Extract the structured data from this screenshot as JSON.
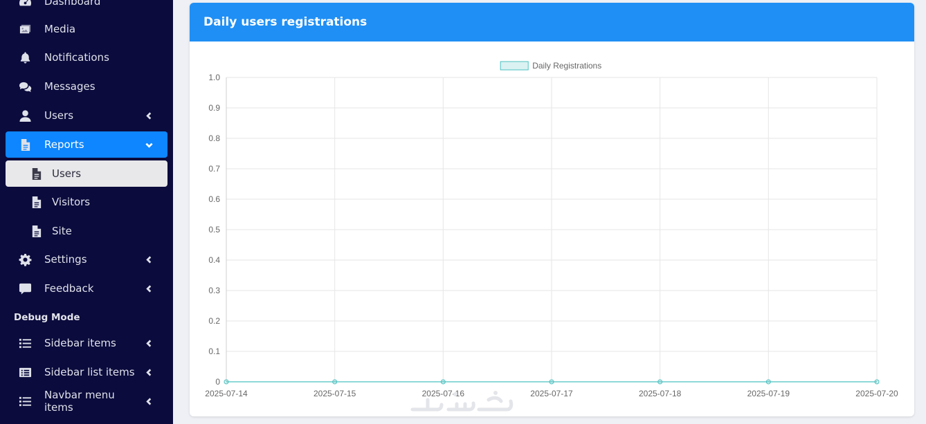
{
  "sidebar": {
    "items": [
      {
        "label": "Dashboard",
        "icon": "dashboard-icon"
      },
      {
        "label": "Media",
        "icon": "images-icon"
      },
      {
        "label": "Notifications",
        "icon": "bell-icon"
      },
      {
        "label": "Messages",
        "icon": "comments-icon"
      },
      {
        "label": "Users",
        "icon": "user-icon"
      },
      {
        "label": "Reports",
        "icon": "file-icon"
      },
      {
        "label": "Users",
        "icon": "file-icon"
      },
      {
        "label": "Visitors",
        "icon": "file-icon"
      },
      {
        "label": "Site",
        "icon": "file-icon"
      },
      {
        "label": "Settings",
        "icon": "gear-icon"
      },
      {
        "label": "Feedback",
        "icon": "comment-icon"
      },
      {
        "label": "Sidebar items",
        "icon": "list-icon"
      },
      {
        "label": "Sidebar list items",
        "icon": "list-alt-icon"
      },
      {
        "label": "Navbar menu items",
        "icon": "list-icon"
      }
    ],
    "section_header": "Debug Mode",
    "accent_color": "#0d86ff",
    "background_color": "#0b0b3d"
  },
  "card": {
    "title": "Daily users registrations",
    "header_color": "#1f8ff5"
  },
  "chart_data": {
    "type": "line",
    "title": "",
    "xlabel": "",
    "ylabel": "",
    "x": [
      "2025-07-14",
      "2025-07-15",
      "2025-07-16",
      "2025-07-17",
      "2025-07-18",
      "2025-07-19",
      "2025-07-20"
    ],
    "series": [
      {
        "name": "Daily Registrations",
        "values": [
          0,
          0,
          0,
          0,
          0,
          0,
          0
        ],
        "color": "#4bc0c0"
      }
    ],
    "ylim": [
      0,
      1.0
    ],
    "yticks": [
      "0",
      "0.1",
      "0.2",
      "0.3",
      "0.4",
      "0.5",
      "0.6",
      "0.7",
      "0.8",
      "0.9",
      "1.0"
    ],
    "grid": true,
    "legend": "top-center"
  }
}
